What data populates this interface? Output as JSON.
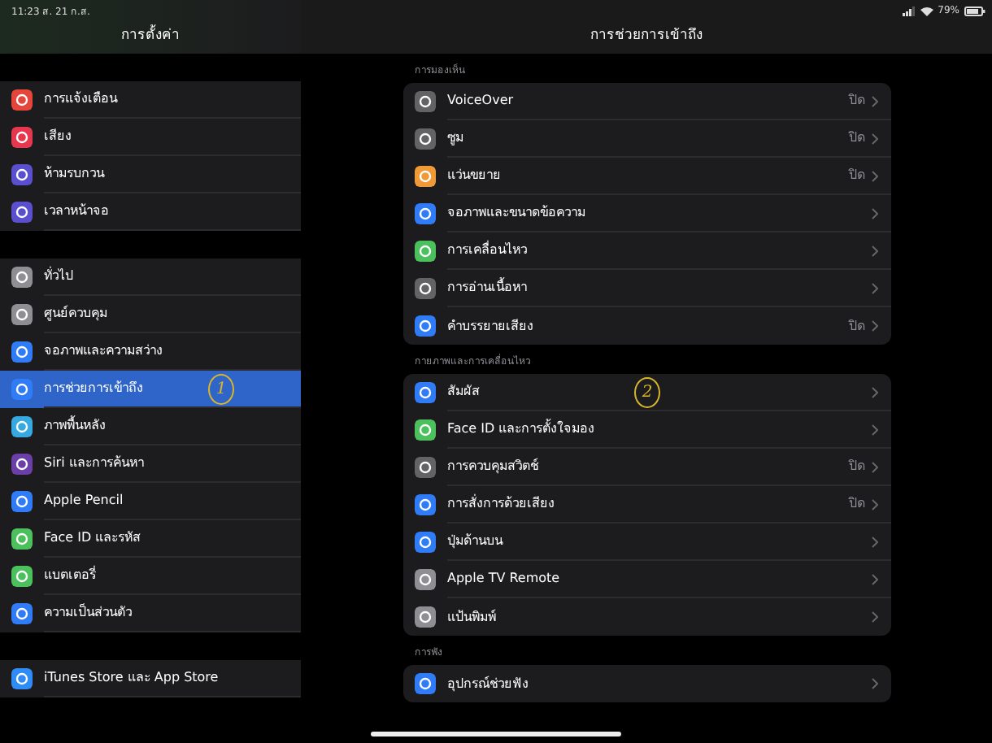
{
  "status_bar": {
    "time": "11:23",
    "date": "ส. 21 ก.ส.",
    "battery": "79%"
  },
  "sidebar": {
    "title": "การตั้งค่า",
    "groups": [
      [
        {
          "label": "การแจ้งเตือน",
          "color": "#e5463c",
          "selected": false
        },
        {
          "label": "เสียง",
          "color": "#e5384f",
          "selected": false
        },
        {
          "label": "ห้ามรบกวน",
          "color": "#5a4fcf",
          "selected": false
        },
        {
          "label": "เวลาหน้าจอ",
          "color": "#5a4fcf",
          "selected": false
        }
      ],
      [
        {
          "label": "ทั่วไป",
          "color": "#8e8e93",
          "selected": false
        },
        {
          "label": "ศูนย์ควบคุม",
          "color": "#8e8e93",
          "selected": false
        },
        {
          "label": "จอภาพและความสว่าง",
          "color": "#2f7cf6",
          "selected": false
        },
        {
          "label": "การช่วยการเข้าถึง",
          "color": "#2f7cf6",
          "selected": true,
          "note": "1"
        },
        {
          "label": "ภาพพื้นหลัง",
          "color": "#36a9e0",
          "selected": false
        },
        {
          "label": "Siri และการค้นหา",
          "color": "#6a3fa8",
          "selected": false
        },
        {
          "label": "Apple Pencil",
          "color": "#2f7cf6",
          "selected": false
        },
        {
          "label": "Face ID และรหัส",
          "color": "#4cc05d",
          "selected": false
        },
        {
          "label": "แบตเตอรี่",
          "color": "#4cc05d",
          "selected": false
        },
        {
          "label": "ความเป็นส่วนตัว",
          "color": "#2f7cf6",
          "selected": false
        }
      ],
      [
        {
          "label": "iTunes Store และ App Store",
          "color": "#2f8cf6",
          "selected": false
        }
      ]
    ]
  },
  "detail": {
    "title": "การช่วยการเข้าถึง",
    "sections": [
      {
        "header": "การมองเห็น",
        "items": [
          {
            "label": "VoiceOver",
            "value": "ปิด",
            "color": "#636366"
          },
          {
            "label": "ซูม",
            "value": "ปิด",
            "color": "#636366"
          },
          {
            "label": "แว่นขยาย",
            "value": "ปิด",
            "color": "#f09a37"
          },
          {
            "label": "จอภาพและขนาดข้อความ",
            "color": "#2f7cf6"
          },
          {
            "label": "การเคลื่อนไหว",
            "color": "#4cc05d"
          },
          {
            "label": "การอ่านเนื้อหา",
            "color": "#636366"
          },
          {
            "label": "คำบรรยายเสียง",
            "value": "ปิด",
            "color": "#2f7cf6"
          }
        ]
      },
      {
        "header": "กายภาพและการเคลื่อนไหว",
        "items": [
          {
            "label": "สัมผัส",
            "color": "#2f7cf6",
            "note": "2"
          },
          {
            "label": "Face ID และการตั้งใจมอง",
            "color": "#4cc05d"
          },
          {
            "label": "การควบคุมสวิตช์",
            "value": "ปิด",
            "color": "#636366"
          },
          {
            "label": "การสั่งการด้วยเสียง",
            "value": "ปิด",
            "color": "#2f7cf6"
          },
          {
            "label": "ปุ่มด้านบน",
            "color": "#2f7cf6"
          },
          {
            "label": "Apple TV Remote",
            "color": "#8e8e93"
          },
          {
            "label": "แป้นพิมพ์",
            "color": "#8e8e93"
          }
        ]
      },
      {
        "header": "การฟัง",
        "items": [
          {
            "label": "อุปกรณ์ช่วยฟัง",
            "color": "#2f7cf6"
          }
        ]
      }
    ]
  }
}
